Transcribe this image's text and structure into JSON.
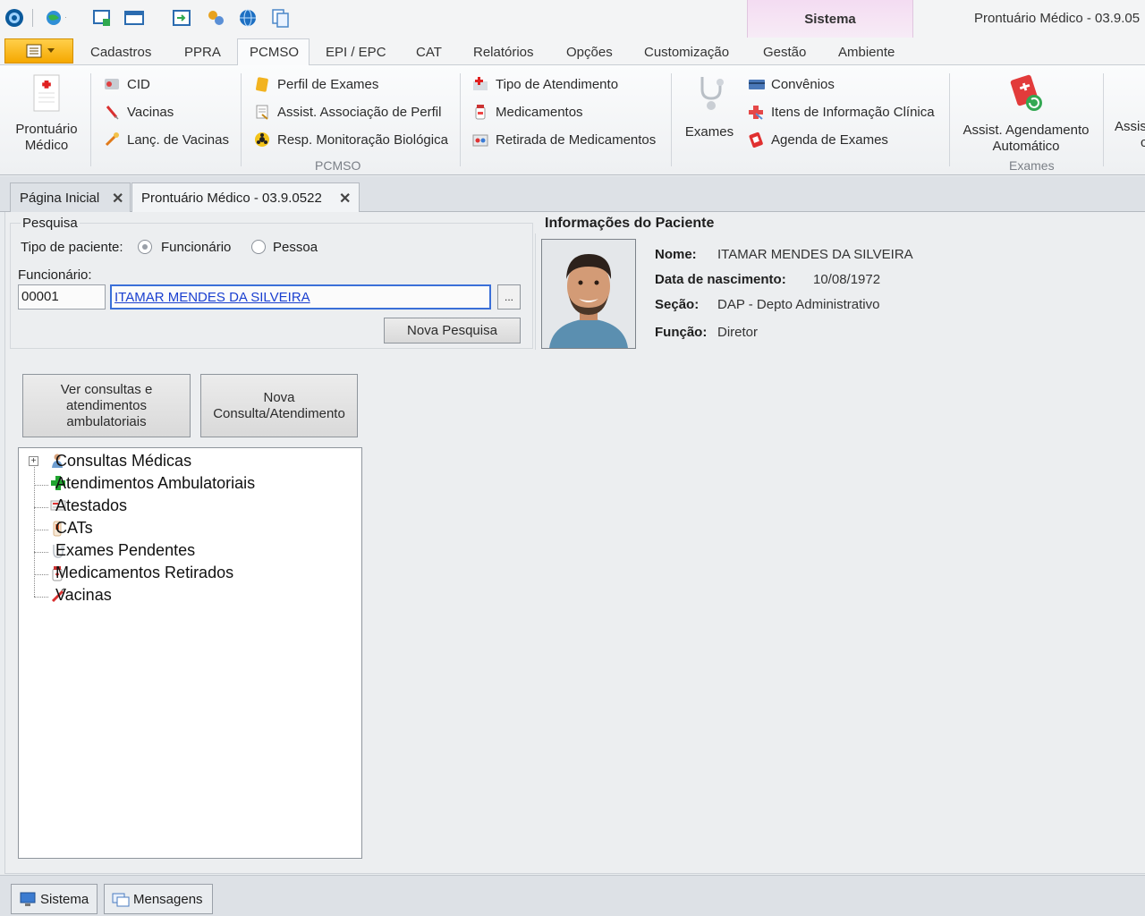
{
  "window": {
    "title": "Prontuário Médico - 03.9.05",
    "context_tab": "Sistema"
  },
  "ribbon_tabs": [
    "Cadastros",
    "PPRA",
    "PCMSO",
    "EPI / EPC",
    "CAT",
    "Relatórios",
    "Opções",
    "Customização",
    "Gestão",
    "Ambiente"
  ],
  "active_tab": "PCMSO",
  "ribbon": {
    "prontuario": "Prontuário Médico",
    "cid": "CID",
    "vacinas": "Vacinas",
    "lanc_vacinas": "Lanç. de Vacinas",
    "perfil_exames": "Perfil de Exames",
    "assist_associacao": "Assist. Associação de  Perfil",
    "resp_monitoracao": "Resp. Monitoração Biológica",
    "tipo_atendimento": "Tipo de Atendimento",
    "medicamentos": "Medicamentos",
    "retirada_medicamentos": "Retirada de Medicamentos",
    "group_pcmso": "PCMSO",
    "exames": "Exames",
    "convenios": "Convênios",
    "itens_info_clinica": "Itens de Informação Clínica",
    "agenda_exames": "Agenda de Exames",
    "assist_agendamento_1": "Assist. Agendamento",
    "assist_agendamento_2": "Automático",
    "group_exames": "Exames",
    "assis_cut_1": "Assis",
    "assis_cut_2": "c"
  },
  "doc_tabs": [
    {
      "label": "Página Inicial"
    },
    {
      "label": "Prontuário Médico - 03.9.0522"
    }
  ],
  "search": {
    "section_title": "Pesquisa",
    "tipo_label": "Tipo de paciente:",
    "option_funcionario": "Funcionário",
    "option_pessoa": "Pessoa",
    "selected": "Funcionário",
    "funcionario_label": "Funcionário:",
    "code_value": "00001",
    "name_value": "ITAMAR MENDES DA SILVEIRA",
    "browse_label": "...",
    "nova_pesquisa": "Nova Pesquisa"
  },
  "patient": {
    "section_title": "Informações do Paciente",
    "nome_label": "Nome:",
    "nome": "ITAMAR MENDES DA SILVEIRA",
    "nasc_label": "Data de nascimento:",
    "nascimento": "10/08/1972",
    "secao_label": "Seção:",
    "secao": "DAP - Depto Administrativo",
    "funcao_label": "Função:",
    "funcao": "Diretor"
  },
  "actions": {
    "ver_consultas": "Ver consultas e atendimentos ambulatoriais",
    "nova_consulta_1": "Nova",
    "nova_consulta_2": "Consulta/Atendimento"
  },
  "tree": [
    "Consultas Médicas",
    "Atendimentos Ambulatoriais",
    "Atestados",
    "CATs",
    "Exames Pendentes",
    "Medicamentos Retirados",
    "Vacinas"
  ],
  "statusbar": {
    "sistema": "Sistema",
    "mensagens": "Mensagens"
  },
  "colors": {
    "accent_orange": "#f5a800",
    "link_blue": "#1a3fd0",
    "context_pink": "#f4dcf2"
  }
}
